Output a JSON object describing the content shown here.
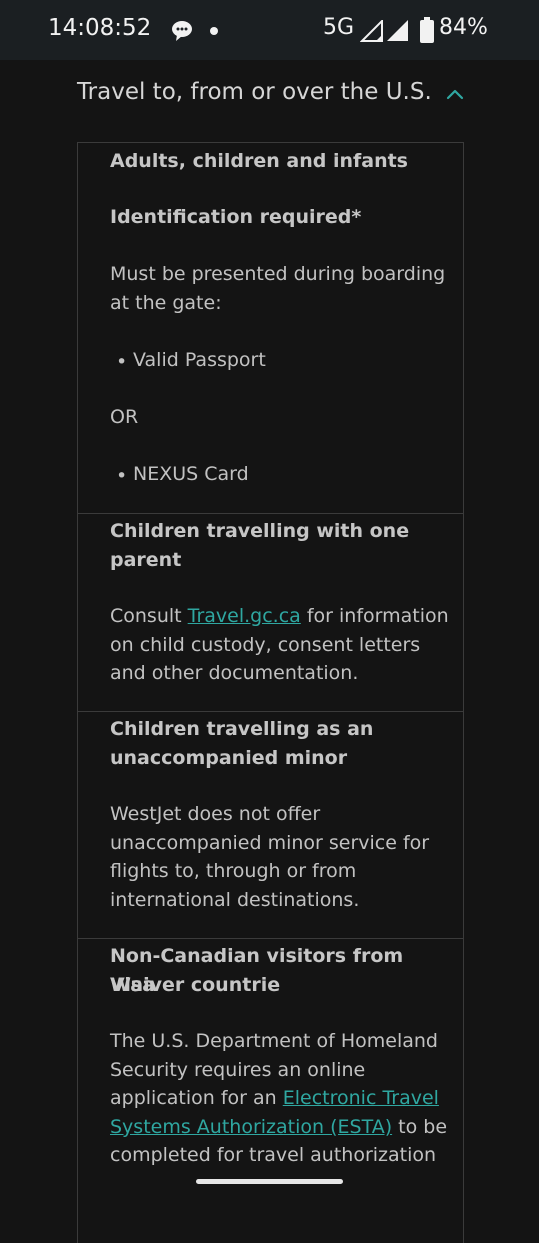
{
  "status_bar": {
    "time": "14:08:52",
    "network": "5G",
    "battery_percent": "84%",
    "icons": [
      "chat-bubble-icon",
      "notification-dot-icon",
      "signal-icon",
      "signal-icon",
      "battery-icon"
    ]
  },
  "section": {
    "title": "Travel to, from or over the U.S.",
    "expanded": true,
    "chevron_icon": "chevron-up-icon",
    "accent_color": "#2fa7a1"
  },
  "rows": [
    {
      "heading": "Adults, children and infants",
      "subheading": "Identification required*",
      "text_line1": "Must be presented during boarding",
      "text_line2": "at the gate:",
      "bullet1": "Valid Passport",
      "or_text": "OR",
      "bullet2": "NEXUS Card"
    },
    {
      "heading_line1": "Children travelling with one",
      "heading_line2": "parent",
      "text_before_link": "Consult ",
      "link_text": "Travel.gc.ca",
      "text_after_link": " for information",
      "text_line2": "on child custody, consent letters",
      "text_line3": "and other documentation."
    },
    {
      "heading_line1": "Children travelling as an",
      "heading_line2": "unaccompanied minor",
      "text_line1": "WestJet does not offer",
      "text_line2": "unaccompanied minor service for",
      "text_line3": "flights to, through or from",
      "text_line4": "international destinations."
    },
    {
      "heading_line1": "Non-Canadian visitors from Visa",
      "heading_line2": "Waiver countrie",
      "text_line1": "The U.S. Department of Homeland",
      "text_line2": "Security requires an online",
      "text_line3_before_link": "application for an ",
      "link_line1": "Electronic Travel",
      "link_line2": "Systems Authorization (ESTA)",
      "text_line4_after_link": " to be",
      "text_line5": "completed for travel authorization"
    }
  ]
}
